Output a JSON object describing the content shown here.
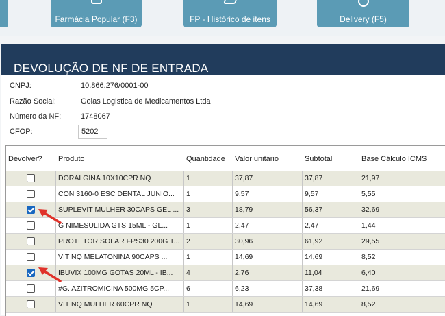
{
  "toolbar": {
    "buttons": [
      {
        "label": "Farmácia Popular (F3)"
      },
      {
        "label": "FP - Histórico de itens"
      },
      {
        "label": "Delivery (F5)"
      }
    ]
  },
  "title": "DEVOLUÇÃO DE NF DE ENTRADA",
  "info": {
    "cnpj_label": "CNPJ:",
    "cnpj": "10.866.276/0001-00",
    "razao_label": "Razão Social:",
    "razao": "Goias Logistica de Medicamentos Ltda",
    "nf_label": "Número da NF:",
    "nf": "1748067",
    "cfop_label": "CFOP:",
    "cfop": "5202"
  },
  "grid": {
    "headers": [
      "Devolver?",
      "Produto",
      "Quantidade",
      "Valor unitário",
      "Subtotal",
      "Base Cálculo ICMS"
    ],
    "rows": [
      {
        "checked": false,
        "produto": "DORALGINA 10X10CPR NQ",
        "qtd": "1",
        "valor": "37,87",
        "subtotal": "37,87",
        "base": "21,97"
      },
      {
        "checked": false,
        "produto": "CON 3160-0 ESC DENTAL JUNIO...",
        "qtd": "1",
        "valor": "9,57",
        "subtotal": "9,57",
        "base": "5,55"
      },
      {
        "checked": true,
        "produto": "SUPLEVIT MULHER 30CAPS GEL ...",
        "qtd": "3",
        "valor": "18,79",
        "subtotal": "56,37",
        "base": "32,69"
      },
      {
        "checked": false,
        "produto": "G NIMESULIDA GTS 15ML - GL...",
        "qtd": "1",
        "valor": "2,47",
        "subtotal": "2,47",
        "base": "1,44"
      },
      {
        "checked": false,
        "produto": "PROTETOR SOLAR FPS30 200G T...",
        "qtd": "2",
        "valor": "30,96",
        "subtotal": "61,92",
        "base": "29,55"
      },
      {
        "checked": false,
        "produto": "VIT NQ MELATONINA 90CAPS ...",
        "qtd": "1",
        "valor": "14,69",
        "subtotal": "14,69",
        "base": "8,52"
      },
      {
        "checked": true,
        "produto": "IBUVIX 100MG GOTAS 20ML - IB...",
        "qtd": "4",
        "valor": "2,76",
        "subtotal": "11,04",
        "base": "6,40"
      },
      {
        "checked": false,
        "produto": "#G. AZITROMICINA 500MG 5CP...",
        "qtd": "6",
        "valor": "6,23",
        "subtotal": "37,38",
        "base": "21,69"
      },
      {
        "checked": false,
        "produto": "VIT NQ MULHER 60CPR NQ",
        "qtd": "1",
        "valor": "14,69",
        "subtotal": "14,69",
        "base": "8,52"
      }
    ]
  },
  "colors": {
    "header_bg": "#213c5c",
    "button_bg": "#5b9bb5",
    "check_on": "#1867c0",
    "arrow": "#e0322a"
  }
}
